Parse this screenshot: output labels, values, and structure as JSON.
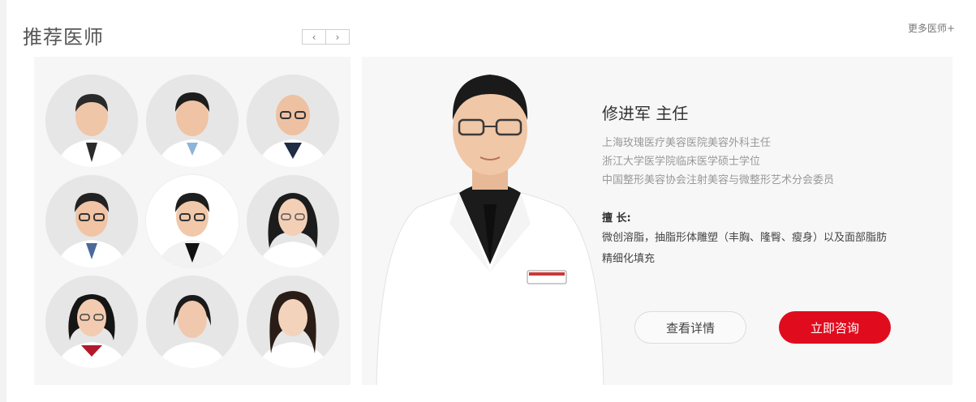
{
  "section": {
    "title": "推荐医师",
    "more_link": "更多医师+",
    "prev_icon": "chevron-left-icon",
    "next_icon": "chevron-right-icon"
  },
  "featured_doctor": {
    "name_title": "修进军 主任",
    "credentials": [
      "上海玫瑰医疗美容医院美容外科主任",
      "浙江大学医学院临床医学硕士学位",
      "中国整形美容协会注射美容与微整形艺术分会委员"
    ],
    "specialty_label": "擅 长:",
    "specialty_text": "微创溶脂，抽脂形体雕塑（丰胸、隆臀、瘦身）以及面部脂肪精细化填充"
  },
  "buttons": {
    "details": "查看详情",
    "consult": "立即咨询"
  },
  "colors": {
    "accent_red": "#e00c1e",
    "panel_bg": "#f6f6f6",
    "avatar_bg": "#e6e6e6"
  }
}
